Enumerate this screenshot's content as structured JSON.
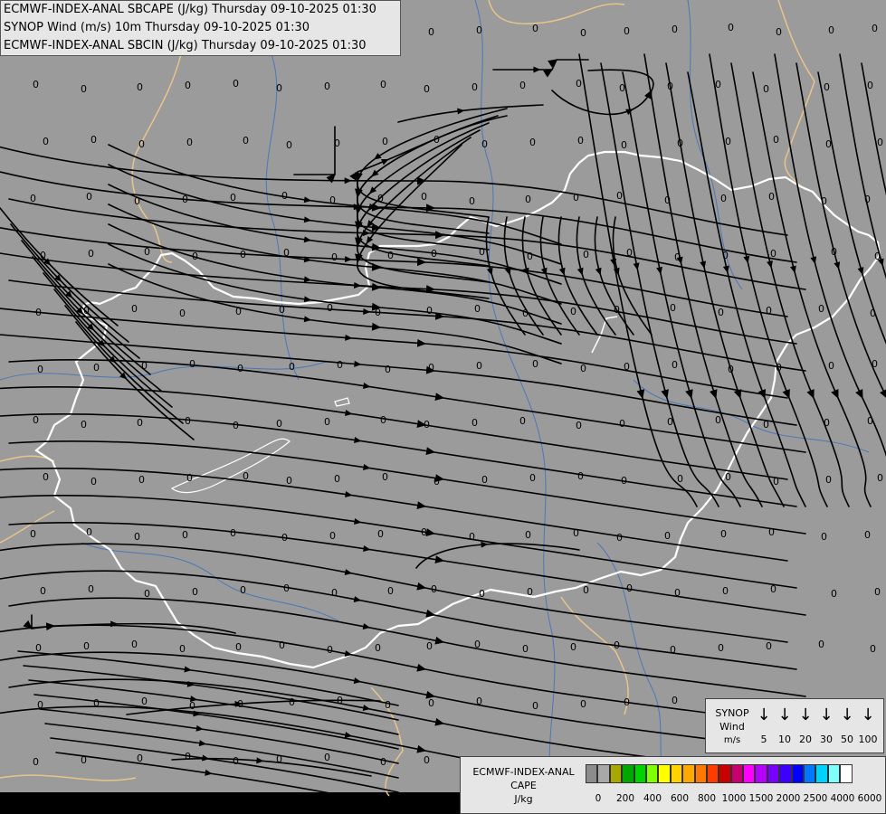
{
  "titles": [
    "ECMWF-INDEX-ANAL SBCAPE (J/kg) Thursday 09-10-2025 01:30",
    "SYNOP Wind (m/s) 10m Thursday 09-10-2025 01:30",
    "ECMWF-INDEX-ANAL SBCIN (J/kg) Thursday 09-10-2025 01:30"
  ],
  "colors": {
    "map_background": "#9b9b9b",
    "border": "#ffffff",
    "neighbour_border": "#e8c48a",
    "rivers": "#4a78b8",
    "streamlines": "#000000",
    "value_text": "#000000"
  },
  "grid_value": "0",
  "wind_legend": {
    "title_lines": [
      "SYNOP",
      "Wind",
      "m/s"
    ],
    "icon": "wind-arrow-down-icon",
    "values": [
      "5",
      "10",
      "20",
      "30",
      "50",
      "100"
    ]
  },
  "cape_legend": {
    "title_lines": [
      "ECMWF-INDEX-ANAL",
      "CAPE",
      "J/kg"
    ],
    "colors": [
      "#8c8c8c",
      "#a8a8a8",
      "#a8a800",
      "#00a800",
      "#00d400",
      "#7fff00",
      "#ffff00",
      "#ffd200",
      "#ffa800",
      "#ff7800",
      "#ff3c00",
      "#c80000",
      "#c8006e",
      "#ff00ff",
      "#b400ff",
      "#7800ff",
      "#3c00ff",
      "#0000ff",
      "#0078ff",
      "#00d2ff",
      "#7fffff",
      "#ffffff"
    ],
    "ticks": [
      "0",
      "200",
      "400",
      "600",
      "800",
      "1000",
      "1500",
      "2000",
      "2500",
      "4000",
      "6000"
    ]
  }
}
